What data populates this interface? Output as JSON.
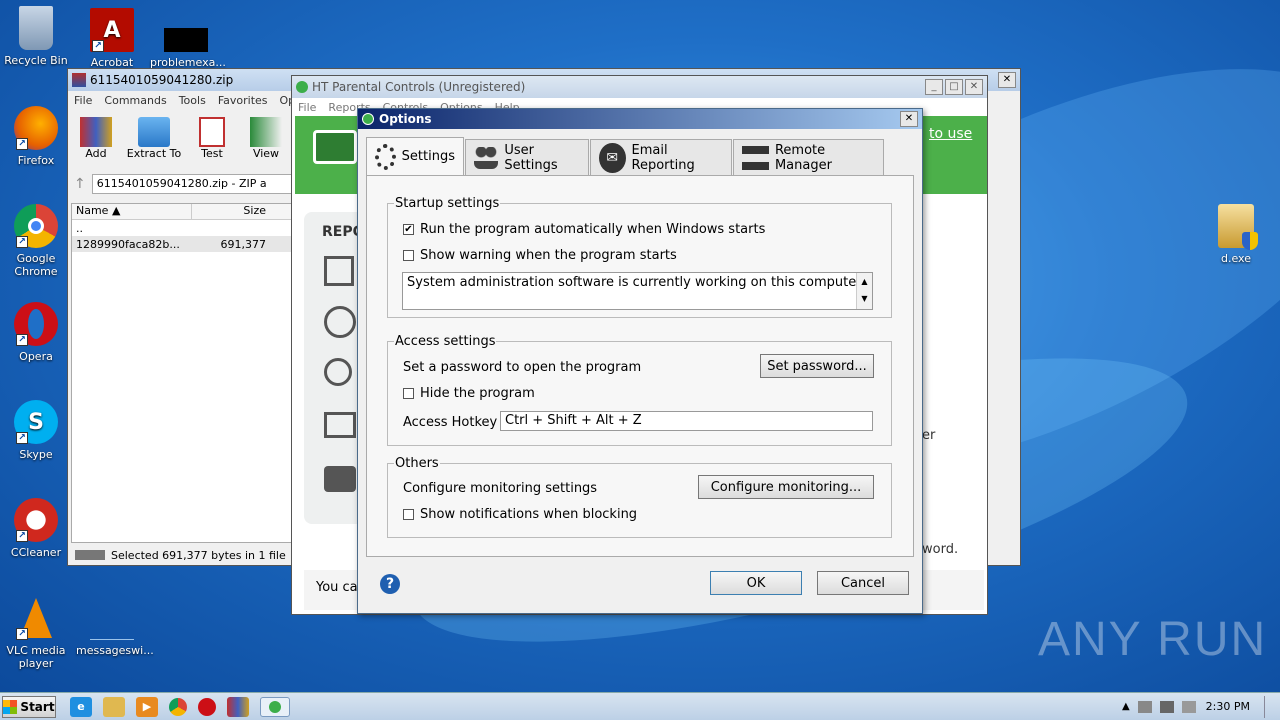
{
  "desktop": {
    "icons": [
      {
        "label": "Recycle Bin",
        "icon": "recycle-bin-icon",
        "color": "#8aa4c0"
      },
      {
        "label": "Firefox",
        "icon": "firefox-icon",
        "color": "#e66000"
      },
      {
        "label": "Google Chrome",
        "icon": "chrome-icon",
        "color": "#2a9d4a"
      },
      {
        "label": "Opera",
        "icon": "opera-icon",
        "color": "#cc0f16"
      },
      {
        "label": "Skype",
        "icon": "skype-icon",
        "color": "#00aff0"
      },
      {
        "label": "CCleaner",
        "icon": "ccleaner-icon",
        "color": "#d0281e"
      },
      {
        "label": "VLC media player",
        "icon": "vlc-icon",
        "color": "#f08a00"
      },
      {
        "label": "Acrobat",
        "icon": "acrobat-icon",
        "color": "#b30b00"
      },
      {
        "label": "problemexa...",
        "icon": "file-icon",
        "color": "#000000"
      },
      {
        "label": "messageswi...",
        "icon": "file-icon",
        "color": "#1f6fc7"
      },
      {
        "label": "d.exe",
        "icon": "exe-installer-icon",
        "color": "#e8c060"
      }
    ],
    "watermark": "ANY RUN"
  },
  "winrar": {
    "title": "6115401059041280.zip",
    "menu": [
      "File",
      "Commands",
      "Tools",
      "Favorites",
      "Options"
    ],
    "toolbar": [
      "Add",
      "Extract To",
      "Test",
      "View"
    ],
    "path": "6115401059041280.zip - ZIP a",
    "columns": [
      "Name",
      "Size"
    ],
    "rows": [
      {
        "name": "..",
        "size": ""
      },
      {
        "name": "1289990faca82b...",
        "size": "691,377"
      }
    ],
    "status": "Selected 691,377 bytes in 1 file"
  },
  "parental": {
    "title": "HT Parental Controls  (Unregistered)",
    "menu": [
      "File",
      "Reports",
      "Controls",
      "Options",
      "Help"
    ],
    "banner_link": "to use",
    "side_heading": "REPO",
    "fragment_er": "er",
    "fragment_word": "word.",
    "bottom_text": "You ca"
  },
  "options": {
    "title": "Options",
    "tabs": [
      {
        "label": "Settings",
        "icon": "gears-icon"
      },
      {
        "label": "User Settings",
        "icon": "users-icon"
      },
      {
        "label": "Email Reporting",
        "icon": "email-icon"
      },
      {
        "label": "Remote Manager",
        "icon": "network-icon"
      }
    ],
    "startup": {
      "legend": "Startup settings",
      "run_auto": "Run the program automatically when Windows starts",
      "run_auto_checked": true,
      "show_warning": "Show warning when the program starts",
      "show_warning_checked": false,
      "warning_text": "System administration software is currently working on this computer."
    },
    "access": {
      "legend": "Access settings",
      "password_label": "Set a password to open the program",
      "password_button": "Set password...",
      "hide_program": "Hide the program",
      "hide_checked": false,
      "hotkey_label": "Access Hotkey",
      "hotkey_value": "Ctrl + Shift + Alt + Z"
    },
    "others": {
      "legend": "Others",
      "configure_label": "Configure monitoring settings",
      "configure_button": "Configure monitoring...",
      "notify": "Show notifications when blocking",
      "notify_checked": false
    },
    "ok": "OK",
    "cancel": "Cancel",
    "help": "?"
  },
  "taskbar": {
    "start": "Start",
    "clock": "2:30 PM"
  }
}
